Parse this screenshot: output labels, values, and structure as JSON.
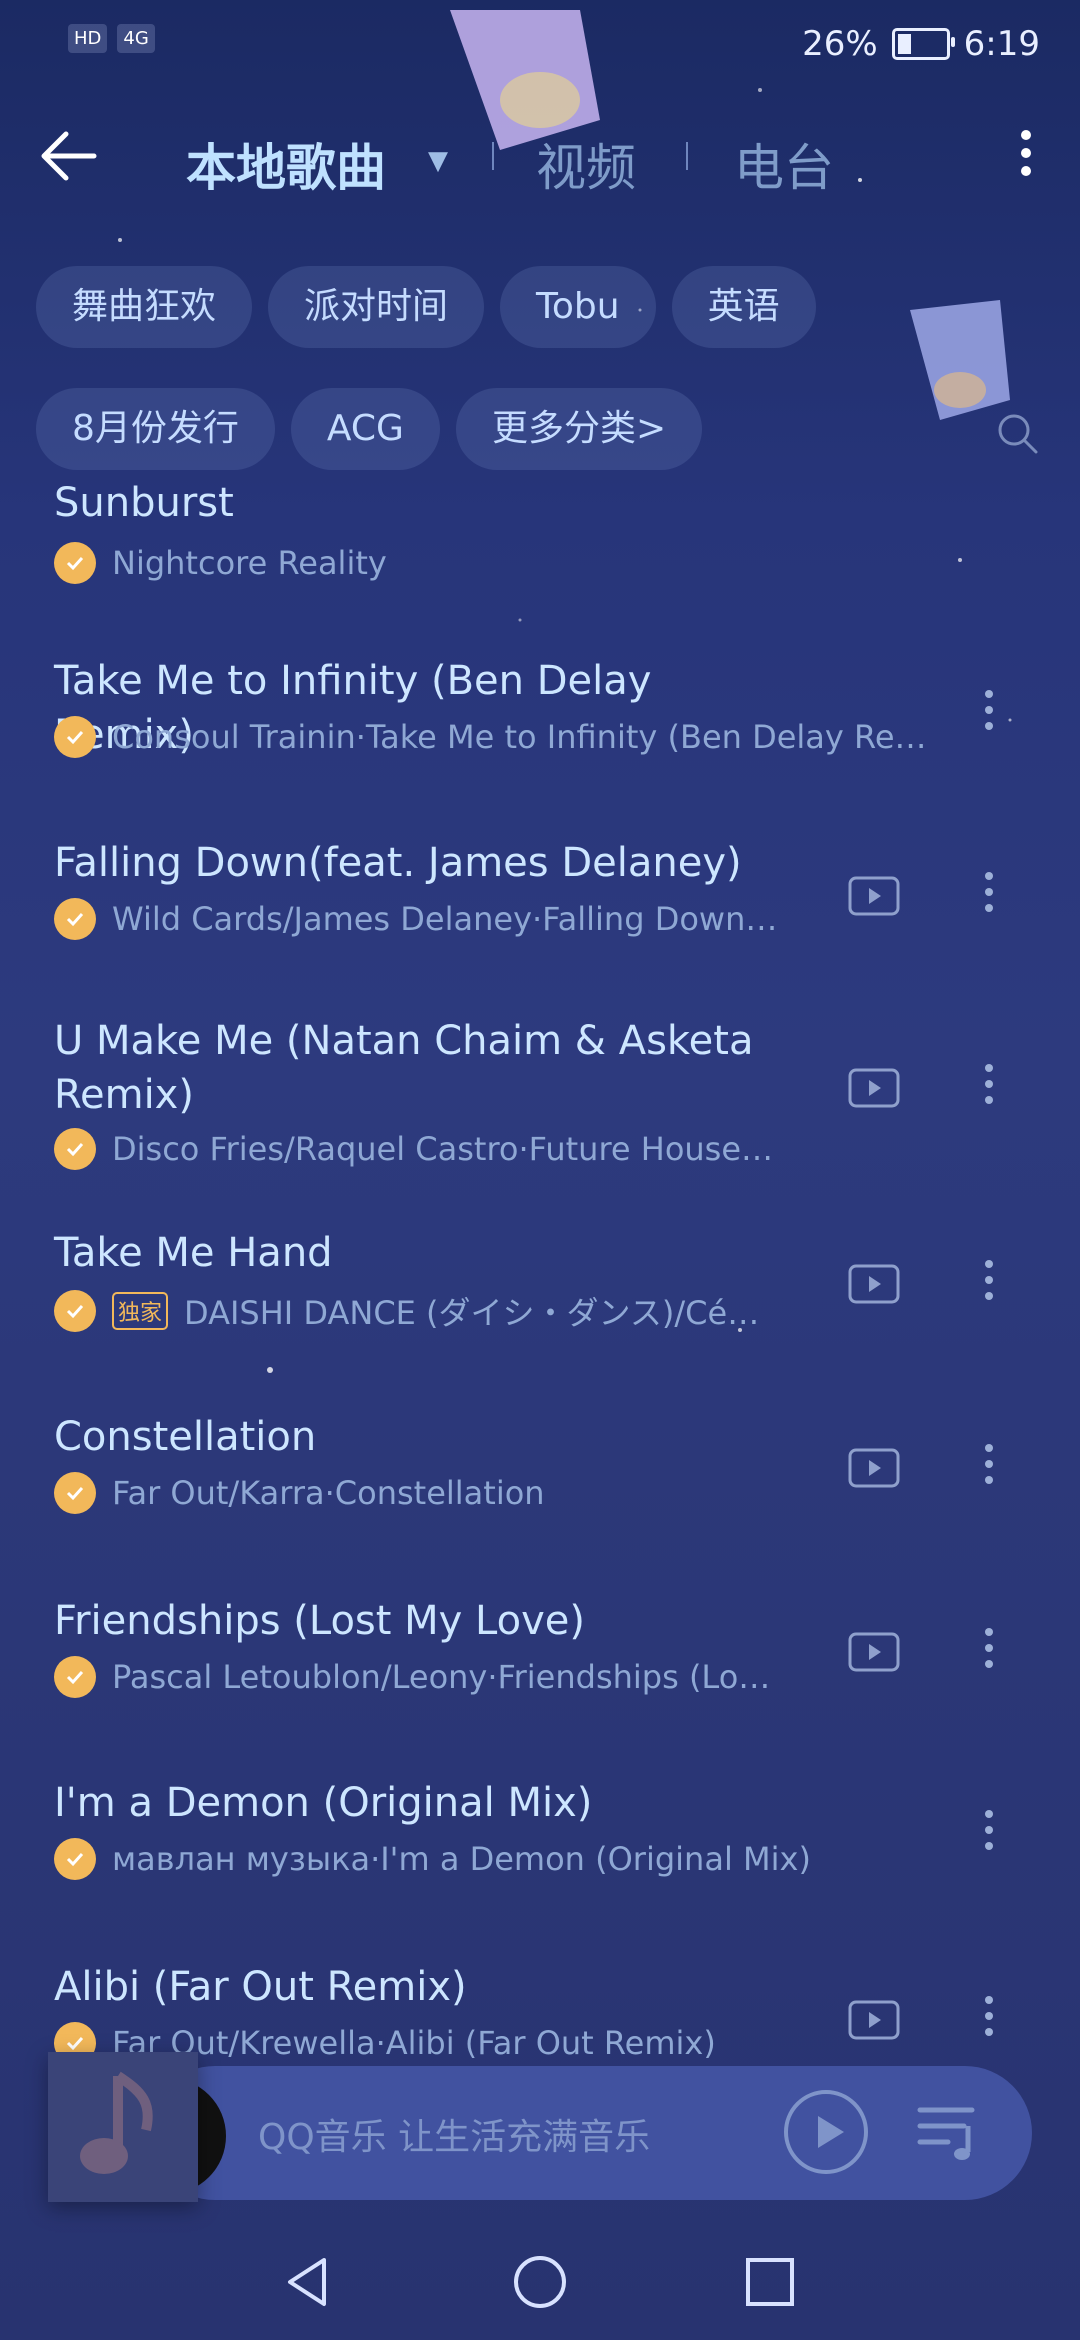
{
  "status_bar": {
    "left_icons": [
      "HD",
      "4G"
    ],
    "battery": "26%",
    "battery_level": 0.26,
    "time": "6:19"
  },
  "header": {
    "tabs": [
      {
        "label": "本地歌曲",
        "active": true
      },
      {
        "label": "视频",
        "active": false
      },
      {
        "label": "电台",
        "active": false
      }
    ],
    "back_icon": "arrow-left-icon",
    "menu_icon": "kebab-icon"
  },
  "filters": {
    "row1": [
      "舞曲狂欢",
      "派对时间",
      "Tobu",
      "英语"
    ],
    "row2": [
      "8月份发行",
      "ACG",
      "更多分类>"
    ]
  },
  "songs": [
    {
      "title": "Sunburst",
      "subtitle": "Nightcore Reality",
      "badge": "",
      "has_mv": false
    },
    {
      "title": "Take Me to Infinity (Ben Delay Remix)",
      "subtitle": "Consoul Trainin·Take Me to Infinity (Ben Delay Re…",
      "badge": "",
      "has_mv": false
    },
    {
      "title": "Falling Down(feat. James Delaney)",
      "subtitle": "Wild Cards/James Delaney·Falling Down…",
      "badge": "",
      "has_mv": true
    },
    {
      "title": "U Make Me (Natan Chaim & Asketa Remix)",
      "subtitle": "Disco Fries/Raquel Castro·Future House…",
      "badge": "",
      "has_mv": true
    },
    {
      "title": "Take Me Hand",
      "subtitle": "DAISHI DANCE (ダイシ・ダンス)/Cé…",
      "badge": "独家",
      "has_mv": true
    },
    {
      "title": "Constellation",
      "subtitle": "Far Out/Karra·Constellation",
      "badge": "",
      "has_mv": true
    },
    {
      "title": "Friendships (Lost My Love)",
      "subtitle": "Pascal Letoublon/Leony·Friendships (Lo…",
      "badge": "",
      "has_mv": true
    },
    {
      "title": "I'm a Demon (Original Mix)",
      "subtitle": "мавлан музыка·I'm a Demon (Original Mix)",
      "badge": "",
      "has_mv": false
    },
    {
      "title": "Alibi (Far Out Remix)",
      "subtitle": "Far Out/Krewella·Alibi (Far Out Remix)",
      "badge": "",
      "has_mv": true
    }
  ],
  "player": {
    "placeholder": "QQ音乐 让生活充满音乐"
  },
  "colors": {
    "accent": "#bfe1ff",
    "check": "#f2b85a",
    "background": "#2b3777"
  }
}
